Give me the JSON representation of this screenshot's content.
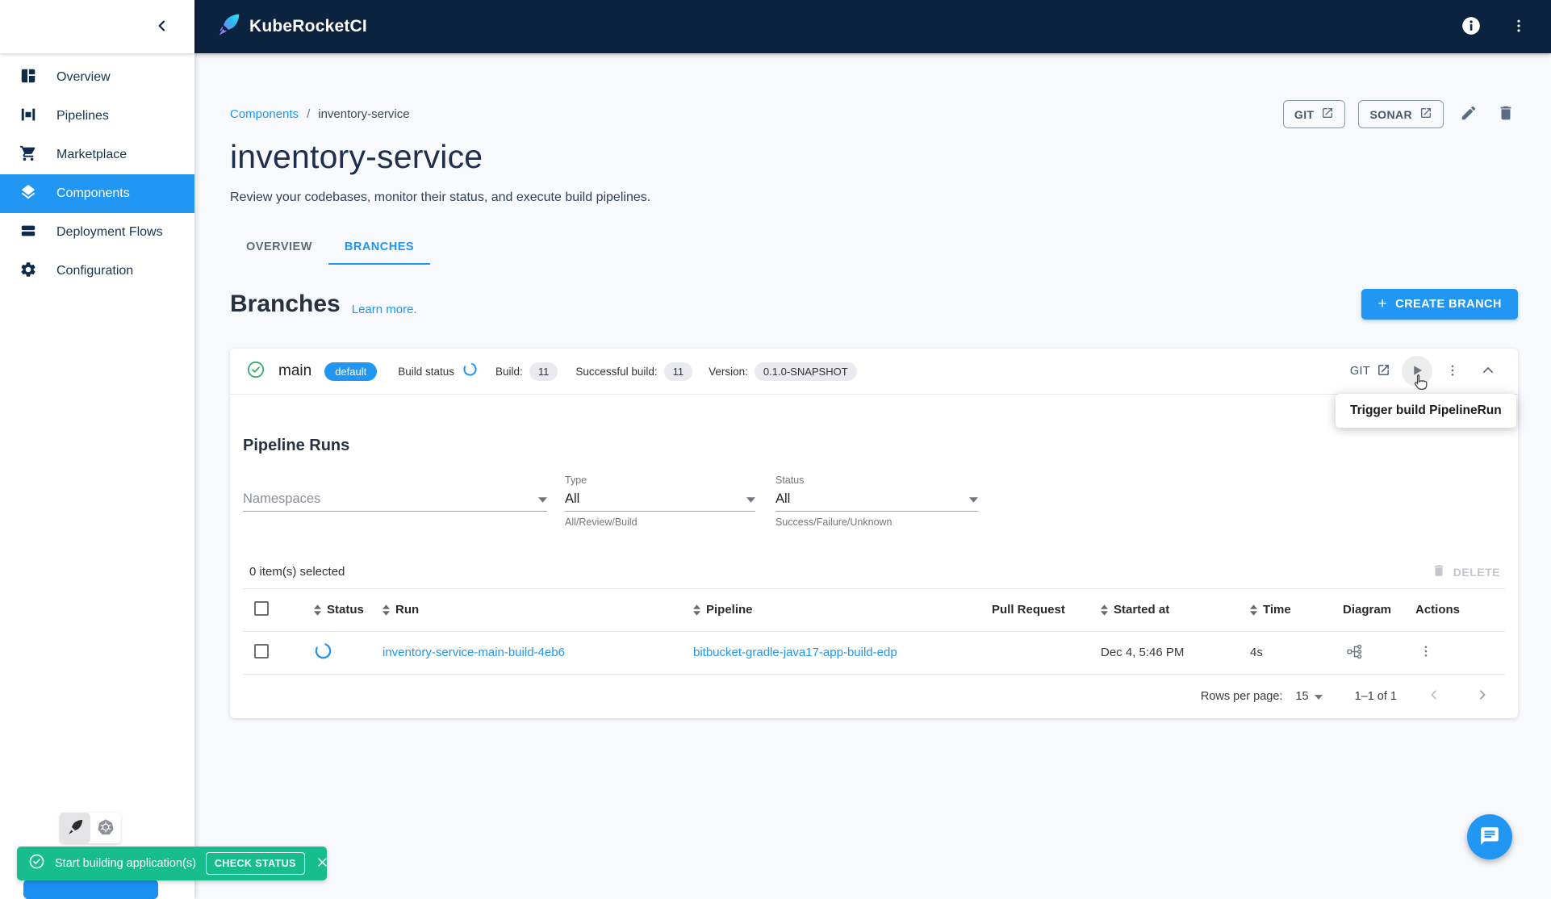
{
  "colors": {
    "accent": "#2196f3",
    "appbar": "#0c2340",
    "success": "#17bd8d"
  },
  "app_bar": {
    "brand": "KubeRocketCI"
  },
  "sidebar": {
    "items": [
      {
        "label": "Overview",
        "icon": "dashboard-icon",
        "active": false
      },
      {
        "label": "Pipelines",
        "icon": "pipelines-icon",
        "active": false
      },
      {
        "label": "Marketplace",
        "icon": "cart-icon",
        "active": false
      },
      {
        "label": "Components",
        "icon": "layers-icon",
        "active": true
      },
      {
        "label": "Deployment Flows",
        "icon": "rows-icon",
        "active": false
      },
      {
        "label": "Configuration",
        "icon": "gear-icon",
        "active": false
      }
    ]
  },
  "page": {
    "breadcrumb": {
      "parent": "Components",
      "separator": "/",
      "current": "inventory-service"
    },
    "title": "inventory-service",
    "description": "Review your codebases, monitor their status, and execute build pipelines.",
    "tabs": [
      {
        "label": "OVERVIEW"
      },
      {
        "label": "BRANCHES"
      }
    ],
    "actions": {
      "git": "GIT",
      "sonar": "SONAR"
    }
  },
  "branches": {
    "heading": "Branches",
    "learn_more": "Learn more.",
    "create_button": "CREATE BRANCH",
    "branch": {
      "name": "main",
      "chip": "default",
      "build_status_label": "Build status",
      "build_label": "Build:",
      "build_count": "11",
      "successful_label": "Successful build:",
      "successful_count": "11",
      "version_label": "Version:",
      "version": "0.1.0-SNAPSHOT",
      "git_label": "GIT"
    },
    "tooltip": "Trigger build PipelineRun"
  },
  "pipeline_runs": {
    "heading": "Pipeline Runs",
    "filters": {
      "namespaces_placeholder": "Namespaces",
      "type_label": "Type",
      "type_value": "All",
      "type_helper": "All/Review/Build",
      "status_label": "Status",
      "status_value": "All",
      "status_helper": "Success/Failure/Unknown"
    },
    "selected_text": "0 item(s) selected",
    "delete_label": "DELETE",
    "table": {
      "columns": [
        "Status",
        "Run",
        "Pipeline",
        "Pull Request",
        "Started at",
        "Time",
        "Diagram",
        "Actions"
      ],
      "rows": [
        {
          "run": "inventory-service-main-build-4eb6",
          "pipeline": "bitbucket-gradle-java17-app-build-edp",
          "pull_request": "",
          "started_at": "Dec 4, 5:46 PM",
          "time": "4s"
        }
      ]
    },
    "pagination": {
      "rows_per_page_label": "Rows per page:",
      "rows_per_page": "15",
      "range": "1–1 of 1"
    }
  },
  "snackbar": {
    "message": "Start building application(s)",
    "action": "CHECK STATUS"
  }
}
